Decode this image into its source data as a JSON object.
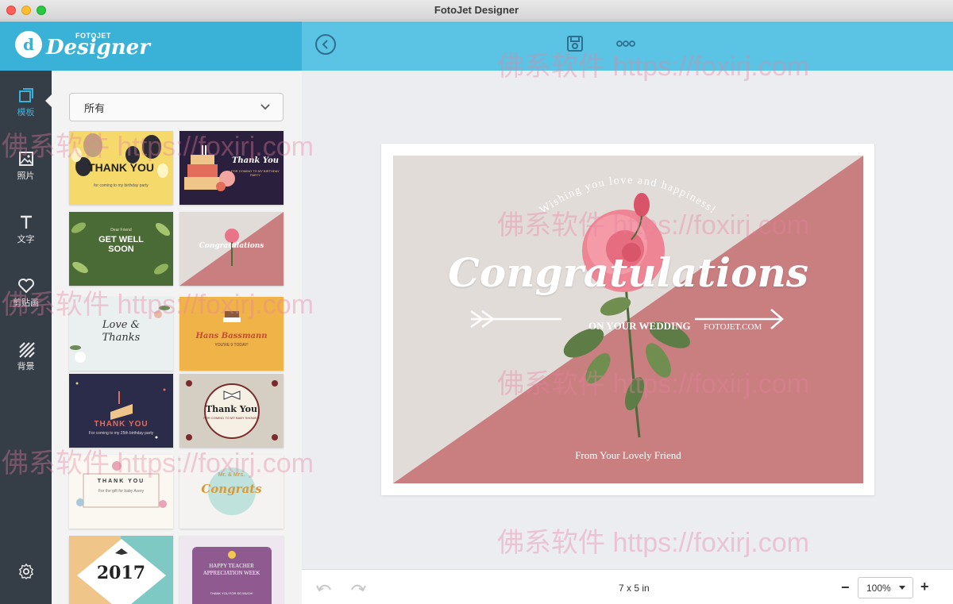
{
  "window": {
    "title": "FotoJet Designer"
  },
  "logo": {
    "small_text": "FOTOJET",
    "big_text": "Designer",
    "mark": "d"
  },
  "sidenav": [
    {
      "label": "模板",
      "icon": "template-icon",
      "active": true
    },
    {
      "label": "照片",
      "icon": "photo-icon",
      "active": false
    },
    {
      "label": "文字",
      "icon": "text-icon",
      "active": false
    },
    {
      "label": "剪贴画",
      "icon": "heart-icon",
      "active": false
    },
    {
      "label": "背景",
      "icon": "background-icon",
      "active": false
    }
  ],
  "panel": {
    "filter": {
      "selected": "所有"
    },
    "templates": [
      {
        "title": "THANK YOU",
        "subtitle": "for coming to my birthday party",
        "bg": "#f5d96a"
      },
      {
        "title": "Thank You",
        "subtitle": "FOR COMING TO MY BIRTHDAY PARTY",
        "bg": "#2a1f3c"
      },
      {
        "title": "GET WELL SOON",
        "subtitle": "Dear Friend",
        "bg": "#4a6b36"
      },
      {
        "title": "Congratulations",
        "subtitle": "",
        "bg": "#e2dcd9"
      },
      {
        "title": "Love & Thanks",
        "subtitle": "",
        "bg": "#eaf0f0"
      },
      {
        "title": "Hans Bassmann",
        "subtitle": "YOU'RE 9 TODAY!",
        "bg": "#f0b347"
      },
      {
        "title": "THANK YOU",
        "subtitle": "For coming to my 25th birthday party",
        "bg": "#2b2b4a"
      },
      {
        "title": "Thank You",
        "subtitle": "FOR COMING TO MY BABY SHOWER",
        "bg": "#d5cfc3"
      },
      {
        "title": "THANK YOU",
        "subtitle": "For the gift for baby Avery",
        "bg": "#fbf8f2"
      },
      {
        "title": "Congrats",
        "subtitle": "Mr. & Mrs.",
        "bg": "#f4f3f1"
      },
      {
        "title": "2017",
        "subtitle": "",
        "bg": "#7fc9c5"
      },
      {
        "title": "HAPPY TEACHER APPRECIATION WEEK",
        "subtitle": "THANK YOU FOR SO MUCH!",
        "bg": "#efe7ef"
      }
    ]
  },
  "card": {
    "arc_text": "Wishing you love and happiness!",
    "title": "Congratulations",
    "subtitle": "ON YOUR WEDDING",
    "brand": "FOTOJET.COM",
    "from": "From Your Lovely Friend",
    "colors": {
      "bg": "#e2dcd9",
      "accent": "#c97e80"
    }
  },
  "bottombar": {
    "size": "7 x 5 in",
    "zoom": "100%"
  },
  "watermark": "佛系软件 https://foxirj.com",
  "colors": {
    "topbar": "#5bc3e3",
    "logo_area": "#3ab1d6",
    "sidenav": "#353d47"
  }
}
